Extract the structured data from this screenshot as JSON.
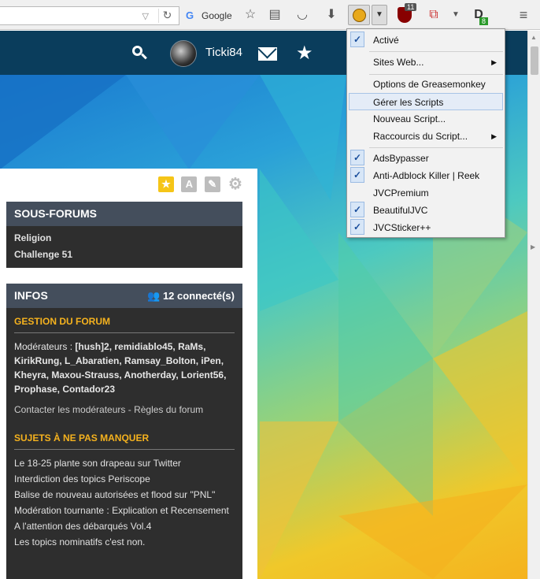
{
  "toolbar": {
    "search_engine": "Google",
    "search_engine_glyph": "G",
    "urlbar_dropdown": "▽",
    "reload": "↻",
    "ublock_badge": "11",
    "extension_badge": "8"
  },
  "header": {
    "username": "Ticki84"
  },
  "panel": {
    "subforums_title": "SOUS-FORUMS",
    "subforums": [
      "Religion",
      "Challenge 51"
    ],
    "infos_title": "INFOS",
    "connected": "12 connecté(s)",
    "gestion_title": "GESTION DU FORUM",
    "moderators_label": "Modérateurs : ",
    "moderators": "[hush]2, remidiablo45, RaMs, KirikRung, L_Abaratien, Ramsay_Bolton, iPen, Kheyra, Maxou-Strauss, Anotherday, Lorient56, Prophase, Contador23",
    "contact_link": "Contacter les modérateurs",
    "separator": " - ",
    "rules_link": "Règles du forum",
    "topics_title": "SUJETS À NE PAS MANQUER",
    "topics": [
      "Le 18-25 plante son drapeau sur Twitter",
      "Interdiction des topics Periscope",
      "Balise de nouveau autorisées et flood sur \"PNL\"",
      "Modération tournante : Explication et Recensement",
      "A l'attention des débarqués Vol.4",
      "Les topics nominatifs c'est non."
    ]
  },
  "menu": {
    "items": [
      {
        "label": "Activé",
        "checked": true
      },
      {
        "label": "Sites Web...",
        "submenu": true
      },
      {
        "label": "Options de Greasemonkey"
      },
      {
        "label": "Gérer les Scripts",
        "highlighted": true
      },
      {
        "label": "Nouveau Script..."
      },
      {
        "label": "Raccourcis du Script...",
        "submenu": true
      },
      {
        "label": "AdsBypasser",
        "checked": true
      },
      {
        "label": "Anti-Adblock Killer | Reek",
        "checked": true
      },
      {
        "label": "JVCPremium",
        "checked": false
      },
      {
        "label": "BeautifulJVC",
        "checked": true
      },
      {
        "label": "JVCSticker++",
        "checked": true
      }
    ],
    "check_glyph": "✓",
    "arrow_glyph": "▶"
  },
  "icons": {
    "panel_letter_a": "A"
  },
  "colors": {
    "header_bg": "#0a3d5c",
    "block_bg": "#2e2e2e",
    "block_header_bg": "#444e5c",
    "section_title": "#f5b21e"
  }
}
